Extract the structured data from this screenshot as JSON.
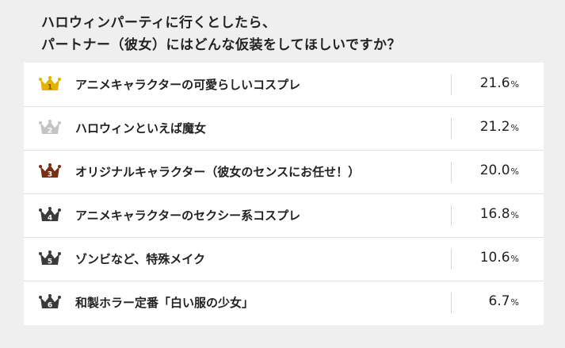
{
  "title": {
    "line1": "ハロウィンパーティに行くとしたら、",
    "line2": "パートナー（彼女）にはどんな仮装をしてほしいですか？"
  },
  "percent_unit": "%",
  "colors": {
    "gold": "#e2b400",
    "silver": "#c4c4c4",
    "bronze": "#7a2e12",
    "dark": "#3a3a3a"
  },
  "rankings": [
    {
      "rank": "1",
      "label": "アニメキャラクターの可愛らしいコスプレ",
      "value": "21.6",
      "crown": "gold-crown-icon",
      "color": "#e2b400"
    },
    {
      "rank": "2",
      "label": "ハロウィンといえば魔女",
      "value": "21.2",
      "crown": "silver-crown-icon",
      "color": "#c4c4c4"
    },
    {
      "rank": "3",
      "label": "オリジナルキャラクター（彼女のセンスにお任せ！）",
      "value": "20.0",
      "crown": "bronze-crown-icon",
      "color": "#7a2e12"
    },
    {
      "rank": "4",
      "label": "アニメキャラクターのセクシー系コスプレ",
      "value": "16.8",
      "crown": "dark-crown-icon",
      "color": "#3a3a3a"
    },
    {
      "rank": "5",
      "label": "ゾンビなど、特殊メイク",
      "value": "10.6",
      "crown": "dark-crown-icon",
      "color": "#3a3a3a"
    },
    {
      "rank": "6",
      "label": "和製ホラー定番「白い服の少女」",
      "value": "6.7",
      "crown": "dark-crown-icon",
      "color": "#3a3a3a"
    }
  ]
}
